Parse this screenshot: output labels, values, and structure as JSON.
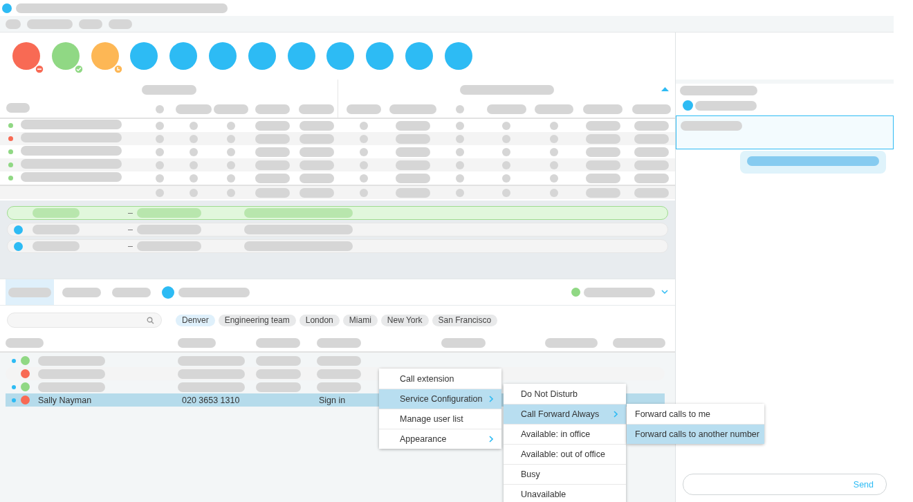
{
  "status_buttons": [
    {
      "color": "#f86a54",
      "kind": "busy"
    },
    {
      "color": "#90d884",
      "kind": "available"
    },
    {
      "color": "#fdb755",
      "kind": "away"
    },
    {
      "color": "#2dbbf4"
    },
    {
      "color": "#2dbbf4"
    },
    {
      "color": "#2dbbf4"
    },
    {
      "color": "#2dbbf4"
    },
    {
      "color": "#2dbbf4"
    },
    {
      "color": "#2dbbf4"
    },
    {
      "color": "#2dbbf4"
    },
    {
      "color": "#2dbbf4"
    },
    {
      "color": "#2dbbf4"
    }
  ],
  "grid_rows": [
    {
      "color": "#90d884"
    },
    {
      "color": "#f86a54"
    },
    {
      "color": "#90d884"
    },
    {
      "color": "#90d884"
    },
    {
      "color": "#90d884"
    },
    {}
  ],
  "calls": [
    {
      "selected": true,
      "separator": "–"
    },
    {
      "selected": false,
      "separator": "–"
    },
    {
      "selected": false,
      "separator": "–"
    }
  ],
  "panel_tabs": [
    {
      "selected": true,
      "icon": false
    },
    {
      "selected": false,
      "icon": false
    },
    {
      "selected": false,
      "icon": false
    },
    {
      "selected": false,
      "icon": true
    }
  ],
  "presence": {
    "color": "#90d884"
  },
  "tags": [
    {
      "label": "Denver",
      "selected": true
    },
    {
      "label": "Engineering team",
      "selected": false
    },
    {
      "label": "London",
      "selected": false
    },
    {
      "label": "Miami",
      "selected": false
    },
    {
      "label": "New York",
      "selected": false
    },
    {
      "label": "San Francisco",
      "selected": false
    }
  ],
  "users": [
    {
      "online": true,
      "color": "#90d884",
      "selected": false
    },
    {
      "online": false,
      "color": "#f86a54",
      "selected": false
    },
    {
      "online": true,
      "color": "#90d884",
      "selected": false
    },
    {
      "online": true,
      "color": "#f86a54",
      "selected": true,
      "name": "Sally Nayman",
      "phone": "020 3653 1310",
      "action": "Sign in"
    }
  ],
  "context_menu": {
    "items": [
      {
        "label": "Call extension",
        "selected": false,
        "submenu": false
      },
      {
        "label": "Service Configuration",
        "selected": true,
        "submenu": true
      },
      {
        "label": "Manage user list",
        "selected": false,
        "submenu": false
      },
      {
        "label": "Appearance",
        "selected": false,
        "submenu": true
      }
    ]
  },
  "service_menu": {
    "items": [
      {
        "label": "Do Not Disturb",
        "selected": false,
        "submenu": false
      },
      {
        "label": "Call Forward Always",
        "selected": true,
        "submenu": true
      },
      {
        "label": "Available: in office",
        "selected": false,
        "submenu": false
      },
      {
        "label": "Available: out of office",
        "selected": false,
        "submenu": false
      },
      {
        "label": "Busy",
        "selected": false,
        "submenu": false
      },
      {
        "label": "Unavailable",
        "selected": false,
        "submenu": false
      }
    ]
  },
  "forward_menu": {
    "items": [
      {
        "label": "Forward calls to me",
        "selected": false,
        "submenu": false
      },
      {
        "label": "Forward calls to another number",
        "selected": true,
        "submenu": false
      }
    ]
  },
  "chat": {
    "send": "Send"
  }
}
